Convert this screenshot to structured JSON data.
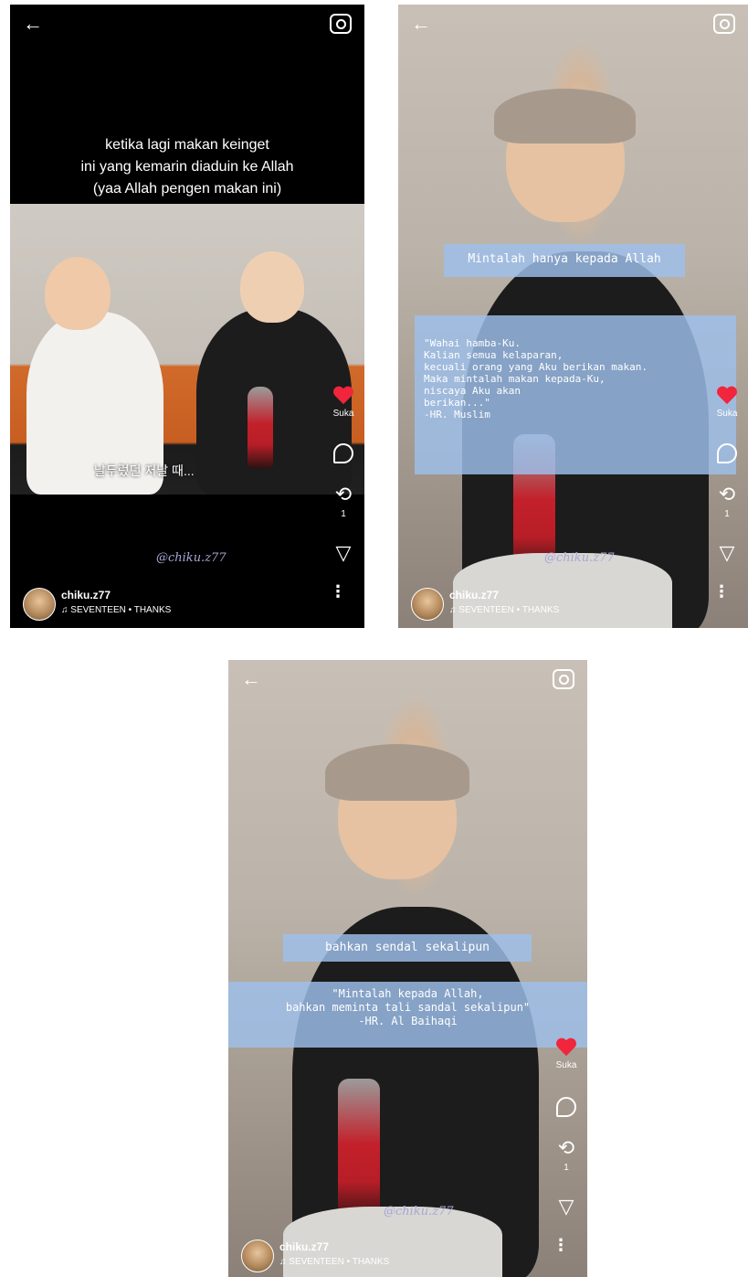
{
  "panel1": {
    "back": "←",
    "caption": [
      "ketika lagi makan keinget",
      "ini yang kemarin diaduin ke Allah",
      "(yaa Allah pengen makan ini)"
    ],
    "hangul": "날두렀던 저날 때...",
    "watermark": "@chiku.z77",
    "like_label": "Suka",
    "repost_count": "1",
    "username": "chiku.z77",
    "music": "♫ SEVENTEEN • THANKS"
  },
  "panel2": {
    "back": "←",
    "heading": "Mintalah hanya kepada Allah",
    "quote": "\"Wahai hamba-Ku.\n Kalian semua kelaparan,\n kecuali orang yang Aku berikan makan.\nMaka mintalah makan kepada-Ku,\nniscaya Aku akan\nberikan...\"\n-HR. Muslim",
    "watermark": "@chiku.z77",
    "like_label": "Suka",
    "repost_count": "1",
    "username": "chiku.z77",
    "music": "♫ SEVENTEEN • THANKS"
  },
  "panel3": {
    "back": "←",
    "heading": "bahkan sendal sekalipun",
    "quote": "\"Mintalah kepada Allah,\nbahkan meminta tali sandal sekalipun\"\n-HR. Al Baihaqi",
    "watermark": "@chiku.z77",
    "like_label": "Suka",
    "repost_count": "1",
    "username": "chiku.z77",
    "music": "♫ SEVENTEEN • THANKS"
  },
  "icons": [
    "back-arrow-icon",
    "camera-icon",
    "heart-icon",
    "comment-icon",
    "repost-icon",
    "share-icon",
    "more-icon"
  ],
  "colors": {
    "like": "#f1253c",
    "overlay_box": "#9dc0ec",
    "watermark": "#a7a6d6"
  }
}
